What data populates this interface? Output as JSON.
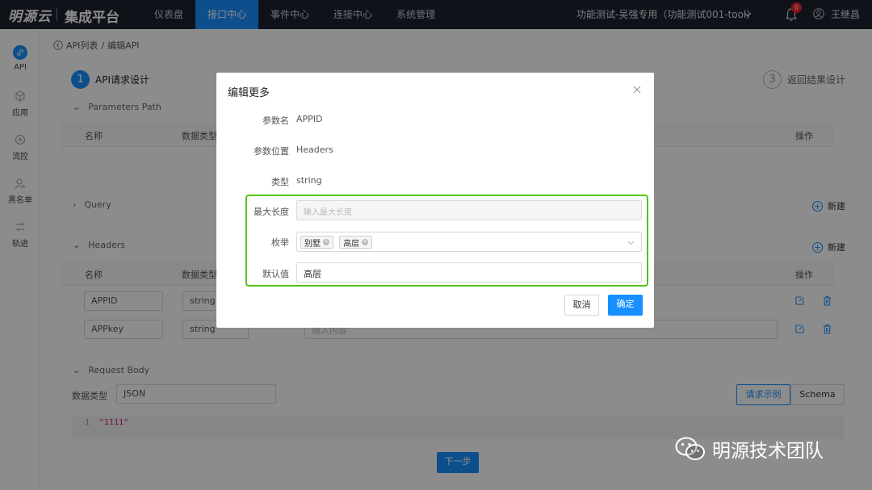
{
  "header": {
    "logo": "明源云",
    "platform": "集成平台",
    "nav": [
      "仪表盘",
      "接口中心",
      "事件中心",
      "连接中心",
      "系统管理"
    ],
    "active_nav_index": 1,
    "project": "功能测试-吴强专用（功能测试001-tool）",
    "notification_count": "0",
    "username": "王继昌"
  },
  "sidebar": {
    "items": [
      {
        "label": "API",
        "icon": "link-icon"
      },
      {
        "label": "应用",
        "icon": "cube-icon"
      },
      {
        "label": "流控",
        "icon": "flow-icon"
      },
      {
        "label": "黑名单",
        "icon": "user-block-icon"
      },
      {
        "label": "轨迹",
        "icon": "trace-icon"
      }
    ]
  },
  "breadcrumb": {
    "parent": "API列表",
    "separator": "/",
    "current": "编辑API"
  },
  "steps": [
    {
      "num": "1",
      "label": "API请求设计"
    },
    {
      "num": "3",
      "label": "返回结果设计"
    }
  ],
  "sections": {
    "path": "Parameters Path",
    "query": "Query",
    "headers": "Headers",
    "body": "Request Body"
  },
  "table_headers": {
    "name": "名称",
    "type": "数据类型",
    "ops": "操作"
  },
  "headers_rows": [
    {
      "name": "APPID",
      "type": "string"
    },
    {
      "name": "APPkey",
      "type": "string",
      "value_placeholder": "输入内容"
    }
  ],
  "new_label": "新建",
  "body": {
    "type_label": "数据类型",
    "type_value": "JSON",
    "example_button": "请求示例",
    "schema_button": "Schema",
    "line_number": "1",
    "code": "\"1111\""
  },
  "next_button": "下一步",
  "modal": {
    "title": "编辑更多",
    "fields": {
      "param_name_label": "参数名",
      "param_name": "APPID",
      "position_label": "参数位置",
      "position": "Headers",
      "type_label": "类型",
      "type": "string",
      "maxlen_label": "最大长度",
      "maxlen_placeholder": "输入最大长度",
      "enum_label": "枚举",
      "enum_tags": [
        "别墅",
        "高层"
      ],
      "default_label": "默认值",
      "default_value": "高层"
    },
    "cancel": "取消",
    "confirm": "确定"
  },
  "watermark": "明源技术团队",
  "colors": {
    "primary": "#1890ff",
    "highlight": "#52c41a",
    "topbar": "#1e2130"
  }
}
